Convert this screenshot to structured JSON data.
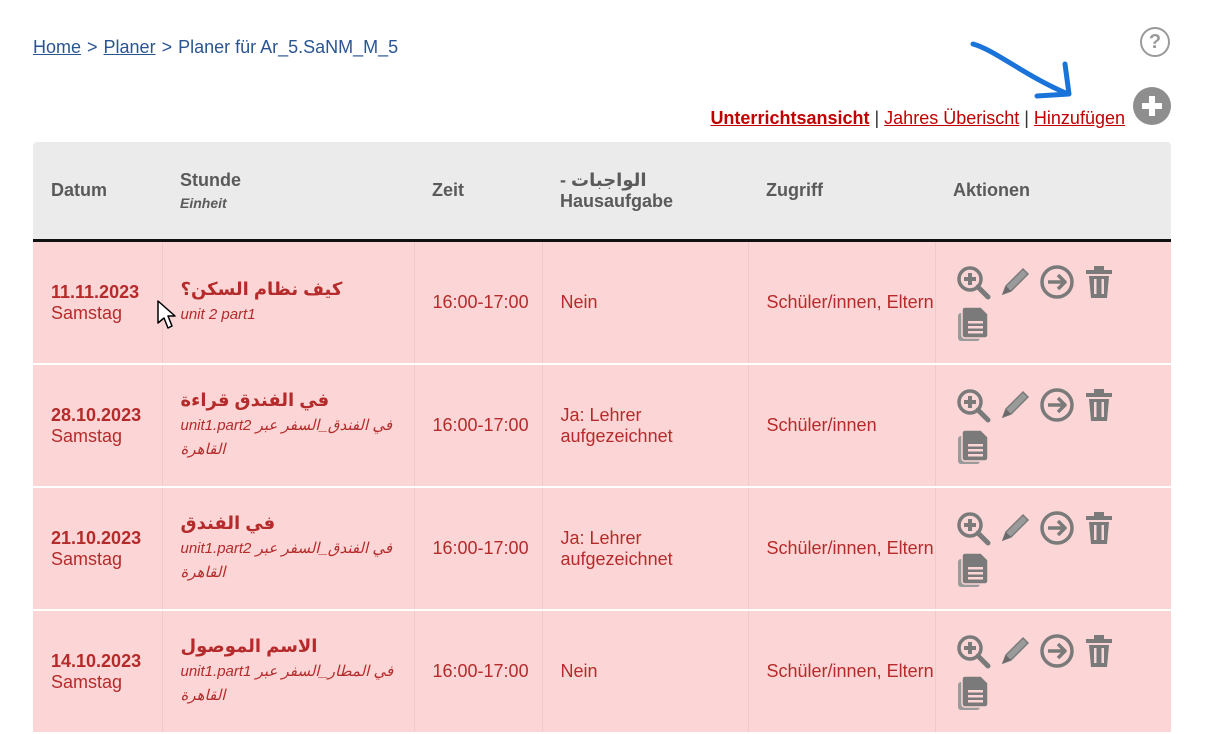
{
  "breadcrumb": {
    "home": "Home",
    "sep": ">",
    "planer": "Planer",
    "current": "Planer für Ar_5.SaNM_M_5"
  },
  "help": {
    "label": "?"
  },
  "view_links": {
    "lesson_view": "Unterrichtsansicht",
    "pipe": "|",
    "year_overview": "Jahres Überischt",
    "add": "Hinzufügen"
  },
  "table": {
    "headers": {
      "date": "Datum",
      "lesson": "Stunde",
      "lesson_sub": "Einheit",
      "time": "Zeit",
      "homework_line1": "- الواجبات",
      "homework_line2": "Hausaufgabe",
      "access": "Zugriff",
      "actions": "Aktionen"
    },
    "rows": [
      {
        "date": "11.11.2023",
        "weekday": "Samstag",
        "title": "كيف نظام السكن؟",
        "unit": "unit 2 part1",
        "time": "16:00-17:00",
        "homework": "Nein",
        "access": "Schüler/innen, Eltern"
      },
      {
        "date": "28.10.2023",
        "weekday": "Samstag",
        "title": "في الفندق قراءة",
        "unit": "unit1.part2 في الفندق_السفر عبر القاهرة",
        "time": "16:00-17:00",
        "homework": "Ja: Lehrer aufgezeichnet",
        "access": "Schüler/innen"
      },
      {
        "date": "21.10.2023",
        "weekday": "Samstag",
        "title": "في الفندق",
        "unit": "unit1.part2 في الفندق_السفر عبر القاهرة",
        "time": "16:00-17:00",
        "homework": "Ja: Lehrer aufgezeichnet",
        "access": "Schüler/innen, Eltern"
      },
      {
        "date": "14.10.2023",
        "weekday": "Samstag",
        "title": "الاسم الموصول",
        "unit": "unit1.part1 في المطار_السفر عبر القاهرة",
        "time": "16:00-17:00",
        "homework": "Nein",
        "access": "Schüler/innen, Eltern"
      }
    ]
  },
  "colors": {
    "link_blue": "#2a5592",
    "link_red": "#c00000",
    "row_bg": "#fcd6d6",
    "row_text": "#b52b2b",
    "header_bg": "#ebebeb",
    "icon_grey": "#7a7a7a",
    "annotation_arrow": "#1a73d9"
  },
  "icons": [
    "help-icon",
    "add-icon",
    "zoom-in-icon",
    "edit-pencil-icon",
    "arrow-right-circle-icon",
    "trash-icon",
    "copy-document-icon",
    "mouse-cursor-icon",
    "annotation-arrow"
  ]
}
